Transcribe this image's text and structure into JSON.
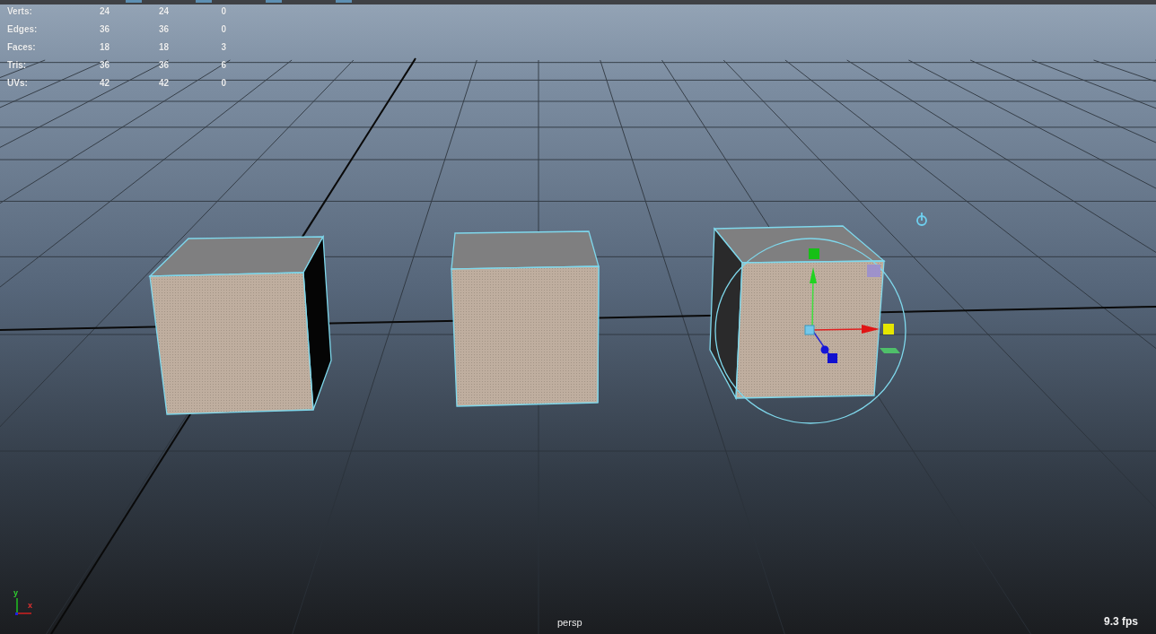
{
  "stats": [
    {
      "label": "Verts:",
      "values": [
        "24",
        "24",
        "0"
      ]
    },
    {
      "label": "Edges:",
      "values": [
        "36",
        "36",
        "0"
      ]
    },
    {
      "label": "Faces:",
      "values": [
        "18",
        "18",
        "3"
      ]
    },
    {
      "label": "Tris:",
      "values": [
        "36",
        "36",
        "6"
      ]
    },
    {
      "label": "UVs:",
      "values": [
        "42",
        "42",
        "0"
      ]
    }
  ],
  "axis": {
    "y": "y",
    "x": "x"
  },
  "camera": "persp",
  "fps": "9.3 fps"
}
